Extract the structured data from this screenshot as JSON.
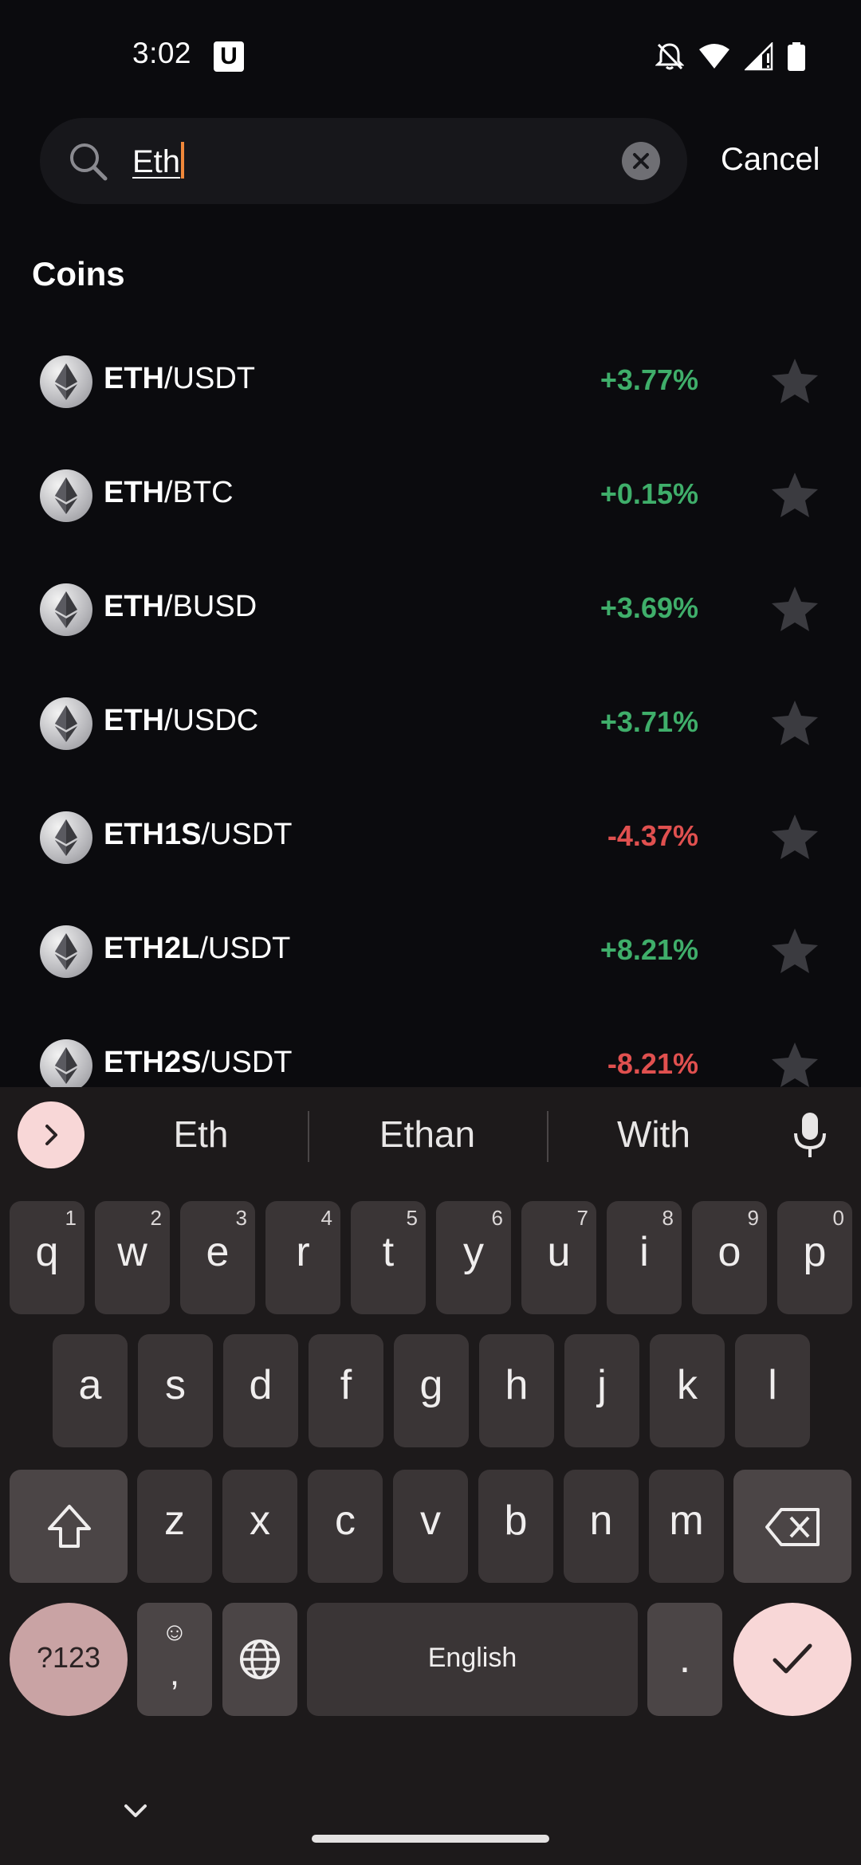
{
  "status_bar": {
    "time": "3:02",
    "app_badge": "U",
    "icons": [
      "bell-off-icon",
      "wifi-icon",
      "signal-icon",
      "battery-icon"
    ]
  },
  "search": {
    "value": "Eth",
    "cancel_label": "Cancel"
  },
  "section_title": "Coins",
  "coins": [
    {
      "base": "ETH",
      "quote": "/USDT",
      "change": "+3.77%",
      "direction": "up"
    },
    {
      "base": "ETH",
      "quote": "/BTC",
      "change": "+0.15%",
      "direction": "up"
    },
    {
      "base": "ETH",
      "quote": "/BUSD",
      "change": "+3.69%",
      "direction": "up"
    },
    {
      "base": "ETH",
      "quote": "/USDC",
      "change": "+3.71%",
      "direction": "up"
    },
    {
      "base": "ETH1S",
      "quote": "/USDT",
      "change": "-4.37%",
      "direction": "down"
    },
    {
      "base": "ETH2L",
      "quote": "/USDT",
      "change": "+8.21%",
      "direction": "up"
    },
    {
      "base": "ETH2S",
      "quote": "/USDT",
      "change": "-8.21%",
      "direction": "down"
    }
  ],
  "colors": {
    "positive": "#3fae6a",
    "negative": "#e0504f",
    "caret": "#f0883a"
  },
  "keyboard": {
    "suggestions": [
      "Eth",
      "Ethan",
      "With"
    ],
    "row1": [
      {
        "key": "q",
        "hint": "1"
      },
      {
        "key": "w",
        "hint": "2"
      },
      {
        "key": "e",
        "hint": "3"
      },
      {
        "key": "r",
        "hint": "4"
      },
      {
        "key": "t",
        "hint": "5"
      },
      {
        "key": "y",
        "hint": "6"
      },
      {
        "key": "u",
        "hint": "7"
      },
      {
        "key": "i",
        "hint": "8"
      },
      {
        "key": "o",
        "hint": "9"
      },
      {
        "key": "p",
        "hint": "0"
      }
    ],
    "row2": [
      "a",
      "s",
      "d",
      "f",
      "g",
      "h",
      "j",
      "k",
      "l"
    ],
    "row3": [
      "z",
      "x",
      "c",
      "v",
      "b",
      "n",
      "m"
    ],
    "symbols_label": "?123",
    "comma_label": ",",
    "emoji_label": "☺",
    "space_label": "English",
    "period_label": "."
  }
}
